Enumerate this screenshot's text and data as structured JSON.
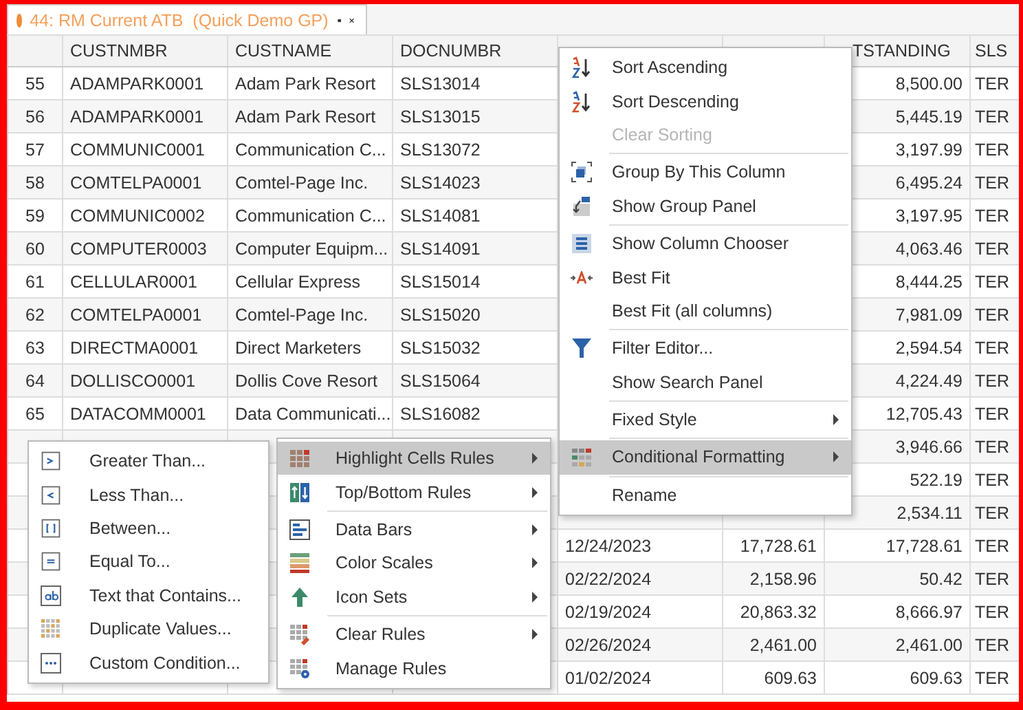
{
  "tab": {
    "title": "44: RM Current ATB  (Quick Demo GP)",
    "active": true
  },
  "table": {
    "columns": [
      "CUSTNMBR",
      "CUSTNAME",
      "DOCNUMBR",
      null,
      null,
      "TSTANDING",
      "SLS"
    ],
    "rows": [
      {
        "number": "55",
        "cells": [
          "ADAMPARK0001",
          "Adam Park Resort",
          "SLS13014",
          null,
          null,
          "8,500.00",
          "TER"
        ]
      },
      {
        "number": "56",
        "cells": [
          "ADAMPARK0001",
          "Adam Park Resort",
          "SLS13015",
          null,
          null,
          "5,445.19",
          "TER"
        ]
      },
      {
        "number": "57",
        "cells": [
          "COMMUNIC0001",
          "Communication C...",
          "SLS13072",
          null,
          null,
          "3,197.99",
          "TER"
        ]
      },
      {
        "number": "58",
        "cells": [
          "COMTELPA0001",
          "Comtel-Page Inc.",
          "SLS14023",
          null,
          null,
          "6,495.24",
          "TER"
        ]
      },
      {
        "number": "59",
        "cells": [
          "COMMUNIC0002",
          "Communication C...",
          "SLS14081",
          null,
          null,
          "3,197.95",
          "TER"
        ]
      },
      {
        "number": "60",
        "cells": [
          "COMPUTER0003",
          "Computer Equipm...",
          "SLS14091",
          null,
          null,
          "4,063.46",
          "TER"
        ]
      },
      {
        "number": "61",
        "cells": [
          "CELLULAR0001",
          "Cellular Express",
          "SLS15014",
          null,
          null,
          "8,444.25",
          "TER"
        ]
      },
      {
        "number": "62",
        "cells": [
          "COMTELPA0001",
          "Comtel-Page Inc.",
          "SLS15020",
          null,
          null,
          "7,981.09",
          "TER"
        ]
      },
      {
        "number": "63",
        "cells": [
          "DIRECTMA0001",
          "Direct Marketers",
          "SLS15032",
          null,
          null,
          "2,594.54",
          "TER"
        ]
      },
      {
        "number": "64",
        "cells": [
          "DOLLISCO0001",
          "Dollis Cove Resort",
          "SLS15064",
          null,
          null,
          "4,224.49",
          "TER"
        ]
      },
      {
        "number": "65",
        "cells": [
          "DATACOMM0001",
          "Data Communicati...",
          "SLS16082",
          null,
          null,
          "12,705.43",
          "TER"
        ]
      },
      {
        "number": null,
        "cells": [
          null,
          null,
          null,
          null,
          null,
          "3,946.66",
          "TER"
        ]
      },
      {
        "number": null,
        "cells": [
          null,
          null,
          null,
          null,
          null,
          "522.19",
          "TER"
        ]
      },
      {
        "number": null,
        "cells": [
          null,
          null,
          null,
          null,
          null,
          "2,534.11",
          "TER"
        ]
      },
      {
        "number": null,
        "cells": [
          null,
          null,
          null,
          "12/24/2023",
          "17,728.61",
          "17,728.61",
          "TER"
        ]
      },
      {
        "number": null,
        "cells": [
          null,
          null,
          null,
          "02/22/2024",
          "2,158.96",
          "50.42",
          "TER"
        ]
      },
      {
        "number": null,
        "cells": [
          null,
          null,
          null,
          "02/19/2024",
          "20,863.32",
          "8,666.97",
          "TER"
        ]
      },
      {
        "number": null,
        "cells": [
          null,
          null,
          null,
          "02/26/2024",
          "2,461.00",
          "2,461.00",
          "TER"
        ]
      },
      {
        "number": null,
        "cells": [
          null,
          null,
          null,
          "01/02/2024",
          "609.63",
          "609.63",
          "TER"
        ]
      }
    ]
  },
  "context_menu": [
    {
      "kind": "item",
      "label": "Sort Ascending",
      "disabled": false,
      "selected": false,
      "submenu": false
    },
    {
      "kind": "item",
      "label": "Sort Descending",
      "disabled": false,
      "selected": false,
      "submenu": false
    },
    {
      "kind": "item",
      "label": "Clear Sorting",
      "disabled": true,
      "selected": false,
      "submenu": false
    },
    {
      "kind": "separator"
    },
    {
      "kind": "item",
      "label": "Group By This Column",
      "disabled": false,
      "selected": false,
      "submenu": false
    },
    {
      "kind": "item",
      "label": "Show Group Panel",
      "disabled": false,
      "selected": false,
      "submenu": false
    },
    {
      "kind": "separator"
    },
    {
      "kind": "item",
      "label": "Show Column Chooser",
      "disabled": false,
      "selected": false,
      "submenu": false
    },
    {
      "kind": "item",
      "label": "Best Fit",
      "disabled": false,
      "selected": false,
      "submenu": false
    },
    {
      "kind": "item",
      "label": "Best Fit (all columns)",
      "disabled": false,
      "selected": false,
      "submenu": false
    },
    {
      "kind": "separator"
    },
    {
      "kind": "item",
      "label": "Filter Editor...",
      "disabled": false,
      "selected": false,
      "submenu": false
    },
    {
      "kind": "item",
      "label": "Show Search Panel",
      "disabled": false,
      "selected": false,
      "submenu": false
    },
    {
      "kind": "separator"
    },
    {
      "kind": "item",
      "label": "Fixed Style",
      "disabled": false,
      "selected": false,
      "submenu": true
    },
    {
      "kind": "separator"
    },
    {
      "kind": "item",
      "label": "Conditional Formatting",
      "disabled": false,
      "selected": true,
      "submenu": true
    },
    {
      "kind": "separator"
    },
    {
      "kind": "item",
      "label": "Rename",
      "disabled": false,
      "selected": false,
      "submenu": false
    }
  ],
  "formatting_menu": [
    {
      "kind": "item",
      "label": "Highlight Cells Rules",
      "selected": true,
      "submenu": true
    },
    {
      "kind": "item",
      "label": "Top/Bottom Rules",
      "selected": false,
      "submenu": true
    },
    {
      "kind": "separator"
    },
    {
      "kind": "item",
      "label": "Data Bars",
      "selected": false,
      "submenu": true
    },
    {
      "kind": "item",
      "label": "Color Scales",
      "selected": false,
      "submenu": true
    },
    {
      "kind": "item",
      "label": "Icon Sets",
      "selected": false,
      "submenu": true
    },
    {
      "kind": "separator"
    },
    {
      "kind": "item",
      "label": "Clear Rules",
      "selected": false,
      "submenu": true
    },
    {
      "kind": "item",
      "label": "Manage Rules",
      "selected": false,
      "submenu": false
    }
  ],
  "highlight_menu": [
    {
      "label": "Greater Than..."
    },
    {
      "label": "Less Than..."
    },
    {
      "label": "Between..."
    },
    {
      "label": "Equal To..."
    },
    {
      "label": "Text that Contains..."
    },
    {
      "label": "Duplicate Values..."
    },
    {
      "label": "Custom Condition..."
    }
  ]
}
